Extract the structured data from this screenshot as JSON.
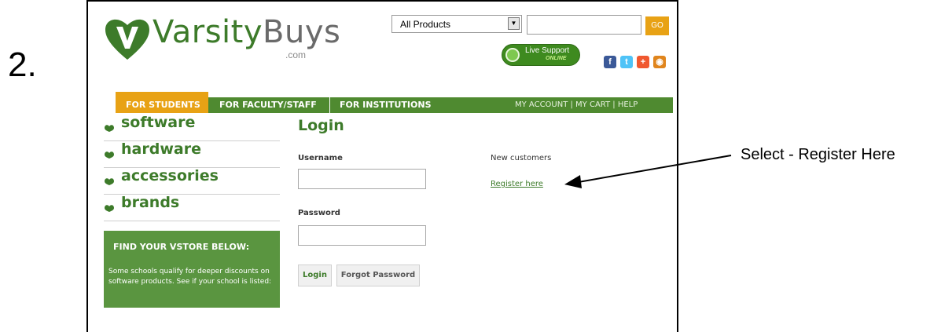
{
  "step": {
    "number": "2."
  },
  "header": {
    "brand_name": "Varsity",
    "brand_suffix": "Buys",
    "brand_tld": ".com",
    "product_select": {
      "selected": "All Products"
    },
    "search": {
      "placeholder": ""
    },
    "go_label": "GO",
    "live_support": {
      "line1": "Live Support",
      "line2": "ONLINE"
    },
    "social_icons": [
      "facebook-icon",
      "twitter-icon",
      "plus-icon",
      "feed-icon"
    ]
  },
  "nav": {
    "items": [
      {
        "label": "FOR STUDENTS",
        "active": true
      },
      {
        "label": "FOR FACULTY/STAFF",
        "active": false
      },
      {
        "label": "FOR INSTITUTIONS",
        "active": false
      }
    ],
    "right_links": "MY ACCOUNT | MY CART | HELP",
    "accent_color": "#e8a215",
    "bar_color": "#4f8a30"
  },
  "sidebar": {
    "categories": [
      {
        "label": "software"
      },
      {
        "label": "hardware"
      },
      {
        "label": "accessories"
      },
      {
        "label": "brands"
      }
    ],
    "vstore": {
      "title": "FIND YOUR VSTORE BELOW:",
      "text": "Some schools qualify for deeper discounts on software products. See if your school is listed:"
    }
  },
  "login": {
    "title": "Login",
    "username_label": "Username",
    "username_value": "",
    "password_label": "Password",
    "password_value": "",
    "login_button": "Login",
    "forgot_button": "Forgot Password"
  },
  "new_customers": {
    "heading": "New customers",
    "register_link": "Register here"
  },
  "annotation": {
    "text": "Select - Register Here"
  }
}
